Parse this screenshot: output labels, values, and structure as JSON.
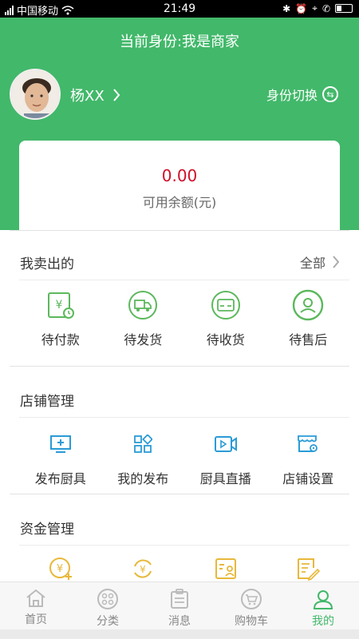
{
  "status_bar": {
    "carrier": "中国移动",
    "time": "21:49"
  },
  "header": {
    "role_title": "当前身份:我是商家",
    "username": "杨XX",
    "switch_label": "身份切换"
  },
  "balance": {
    "amount": "0.00",
    "label": "可用余额(元)"
  },
  "orders": {
    "title": "我卖出的",
    "more_label": "全部",
    "items": [
      {
        "label": "待付款",
        "icon": "payment-icon"
      },
      {
        "label": "待发货",
        "icon": "truck-icon"
      },
      {
        "label": "待收货",
        "icon": "receive-icon"
      },
      {
        "label": "待售后",
        "icon": "service-icon"
      }
    ]
  },
  "shop": {
    "title": "店铺管理",
    "items": [
      {
        "label": "发布厨具",
        "icon": "publish-icon"
      },
      {
        "label": "我的发布",
        "icon": "my-publish-icon"
      },
      {
        "label": "厨具直播",
        "icon": "live-icon"
      },
      {
        "label": "店铺设置",
        "icon": "shop-settings-icon"
      }
    ]
  },
  "funds": {
    "title": "资金管理",
    "items": [
      {
        "icon": "recharge-icon"
      },
      {
        "icon": "withdraw-icon"
      },
      {
        "icon": "account-icon"
      },
      {
        "icon": "bill-icon"
      }
    ]
  },
  "tabbar": {
    "items": [
      {
        "label": "首页",
        "icon": "home-icon"
      },
      {
        "label": "分类",
        "icon": "category-icon"
      },
      {
        "label": "消息",
        "icon": "message-icon"
      },
      {
        "label": "购物车",
        "icon": "cart-icon"
      },
      {
        "label": "我的",
        "icon": "profile-icon"
      }
    ],
    "active_index": 4
  },
  "colors": {
    "brand_green": "#42b86a",
    "amount_red": "#d0102a",
    "order_icon_green": "#5cb85c",
    "shop_icon_blue": "#2a9bd6",
    "funds_icon_yellow": "#e8b83a"
  }
}
